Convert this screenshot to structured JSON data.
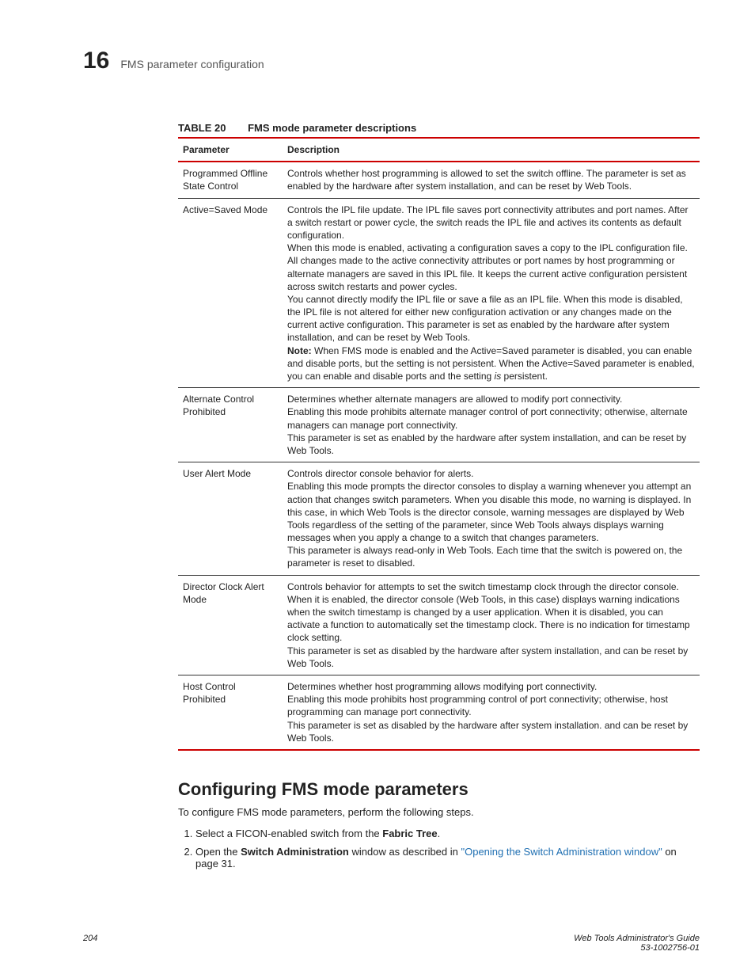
{
  "header": {
    "chapter_number": "16",
    "chapter_title": "FMS parameter configuration"
  },
  "table": {
    "label": "TABLE 20",
    "title": "FMS mode parameter descriptions",
    "col1": "Parameter",
    "col2": "Description",
    "rows": [
      {
        "param": "Programmed Offline State Control",
        "desc": [
          {
            "t": "p",
            "v": "Controls whether host programming is allowed to set the switch offline. The parameter is set as enabled by the hardware after system installation, and can be reset by Web Tools."
          }
        ]
      },
      {
        "param": "Active=Saved Mode",
        "desc": [
          {
            "t": "p",
            "v": "Controls the IPL file update. The IPL file saves port connectivity attributes and port names. After a switch restart or power cycle, the switch reads the IPL file and actives its contents as default configuration."
          },
          {
            "t": "p",
            "v": "When this mode is enabled, activating a configuration saves a copy to the IPL configuration file. All changes made to the active connectivity attributes or port names by host programming or alternate managers are saved in this IPL file. It keeps the current active configuration persistent across switch restarts and power cycles."
          },
          {
            "t": "p",
            "v": "You cannot directly modify the IPL file or save a file as an IPL file. When this mode is disabled, the IPL file is not altered for either new configuration activation or any changes made on the current active configuration. This parameter is set as enabled by the hardware after system installation, and can be reset by Web Tools."
          },
          {
            "t": "note",
            "label": "Note:",
            "v1": " When FMS mode is enabled and the Active=Saved parameter is disabled, you can enable and disable ports, but the setting is not persistent. When the Active=Saved parameter is enabled, you can enable and disable ports and the setting ",
            "em": "is",
            "v2": " persistent."
          }
        ]
      },
      {
        "param": "Alternate Control Prohibited",
        "desc": [
          {
            "t": "p",
            "v": "Determines whether alternate managers are allowed to modify port connectivity."
          },
          {
            "t": "p",
            "v": "Enabling this mode prohibits alternate manager control of port connectivity; otherwise, alternate managers can manage port connectivity."
          },
          {
            "t": "p",
            "v": "This parameter is set as enabled by the hardware after system installation, and can be reset by Web Tools."
          }
        ]
      },
      {
        "param": "User Alert Mode",
        "desc": [
          {
            "t": "p",
            "v": "Controls director console behavior for alerts."
          },
          {
            "t": "p",
            "v": "Enabling this mode prompts the director consoles to display a warning whenever you attempt an action that changes switch parameters. When you disable this mode, no warning is displayed. In this case, in which Web Tools is the director console, warning messages are displayed by Web Tools regardless of the setting of the parameter, since Web Tools always displays warning messages when you apply a change to a switch that changes parameters."
          },
          {
            "t": "p",
            "v": "This parameter is always read-only in Web Tools. Each time that the switch is powered on, the parameter is reset to disabled."
          }
        ]
      },
      {
        "param": "Director Clock Alert Mode",
        "desc": [
          {
            "t": "p",
            "v": "Controls behavior for attempts to set the switch timestamp clock through the director console."
          },
          {
            "t": "p",
            "v": "When it is enabled, the director console (Web Tools, in this case) displays warning indications when the switch timestamp is changed by a user application. When it is disabled, you can activate a function to automatically set the timestamp clock. There is no indication for timestamp clock setting."
          },
          {
            "t": "p",
            "v": "This parameter is set as disabled by the hardware after system installation, and can be reset by Web Tools."
          }
        ]
      },
      {
        "param": "Host Control Prohibited",
        "desc": [
          {
            "t": "p",
            "v": "Determines whether host programming allows modifying port connectivity."
          },
          {
            "t": "p",
            "v": "Enabling this mode prohibits host programming control of port connectivity; otherwise, host programming can manage port connectivity."
          },
          {
            "t": "p",
            "v": "This parameter is set as disabled by the hardware after system installation. and can be reset by Web Tools."
          }
        ]
      }
    ]
  },
  "section": {
    "heading": "Configuring FMS mode parameters",
    "intro": "To configure FMS mode parameters, perform the following steps.",
    "steps": {
      "s1_pre": "Select a FICON-enabled switch from the ",
      "s1_bold": "Fabric Tree",
      "s1_post": ".",
      "s2_pre": "Open the ",
      "s2_bold": "Switch Administration",
      "s2_mid": " window as described in ",
      "s2_link": "\"Opening the Switch Administration window\"",
      "s2_post": " on page 31."
    }
  },
  "footer": {
    "page": "204",
    "guide": "Web Tools Administrator's Guide",
    "docnum": "53-1002756-01"
  }
}
